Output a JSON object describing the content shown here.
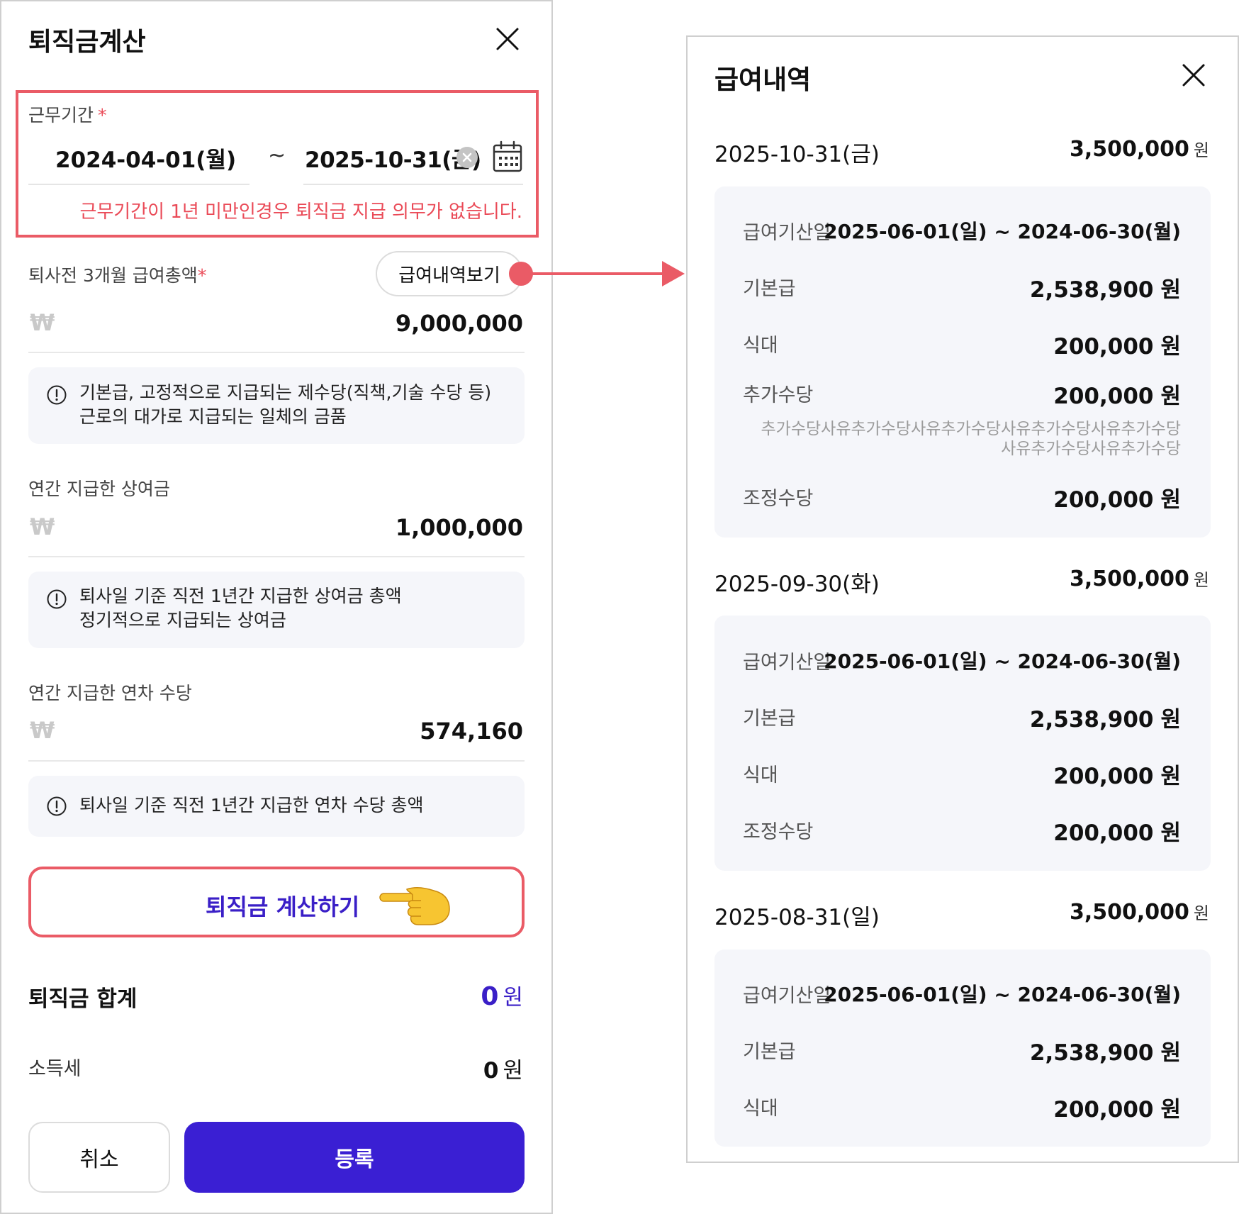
{
  "left_panel": {
    "title": "퇴직금계산",
    "period": {
      "label": "근무기간",
      "required_mark": "*",
      "start": "2024-04-01(월)",
      "separator": "~",
      "end": "2025-10-31(금)",
      "warning": "근무기간이 1년 미만인경우 퇴직금 지급 의무가 없습니다."
    },
    "salary3": {
      "label": "퇴사전 3개월 급여총액",
      "required_mark": "*",
      "history_button": "급여내역보기",
      "currency": "₩",
      "value": "9,000,000",
      "info_line1": "기본급, 고정적으로 지급되는 제수당(직책,기술 수당 등)",
      "info_line2": "근로의 대가로 지급되는 일체의 금품"
    },
    "bonus": {
      "label": "연간 지급한 상여금",
      "currency": "₩",
      "value": "1,000,000",
      "info_line1": "퇴사일 기준 직전 1년간 지급한 상여금 총액",
      "info_line2": "정기적으로 지급되는 상여금"
    },
    "leave": {
      "label": "연간 지급한 연차 수당",
      "currency": "₩",
      "value": "574,160",
      "info_line1": "퇴사일 기준 직전 1년간 지급한 연차 수당 총액"
    },
    "calc_button": "퇴직금 계산하기",
    "total": {
      "label": "퇴직금 합계",
      "value": "0",
      "unit": "원"
    },
    "tax": {
      "label": "소득세",
      "value": "0",
      "unit": "원"
    },
    "cancel_button": "취소",
    "submit_button": "등록"
  },
  "right_panel": {
    "title": "급여내역",
    "records": [
      {
        "date": "2025-10-31(금)",
        "total": "3,500,000",
        "total_unit": "원",
        "period_label": "급여기산일",
        "period": "2025-06-01(일) ~ 2024-06-30(월)",
        "items": [
          {
            "label": "기본급",
            "amount": "2,538,900",
            "unit": "원"
          },
          {
            "label": "식대",
            "amount": "200,000",
            "unit": "원"
          },
          {
            "label": "추가수당",
            "amount": "200,000",
            "unit": "원",
            "note": "추가수당사유추가수당사유추가수당사유추가수당사유추가수당사유추가수당사유추가수당"
          },
          {
            "label": "조정수당",
            "amount": "200,000",
            "unit": "원"
          }
        ]
      },
      {
        "date": "2025-09-30(화)",
        "total": "3,500,000",
        "total_unit": "원",
        "period_label": "급여기산일",
        "period": "2025-06-01(일) ~ 2024-06-30(월)",
        "items": [
          {
            "label": "기본급",
            "amount": "2,538,900",
            "unit": "원"
          },
          {
            "label": "식대",
            "amount": "200,000",
            "unit": "원"
          },
          {
            "label": "조정수당",
            "amount": "200,000",
            "unit": "원"
          }
        ]
      },
      {
        "date": "2025-08-31(일)",
        "total": "3,500,000",
        "total_unit": "원",
        "period_label": "급여기산일",
        "period": "2025-06-01(일) ~ 2024-06-30(월)",
        "items": [
          {
            "label": "기본급",
            "amount": "2,538,900",
            "unit": "원"
          },
          {
            "label": "식대",
            "amount": "200,000",
            "unit": "원"
          }
        ]
      }
    ]
  },
  "colors": {
    "accent": "#3a1fd3",
    "highlight": "#ea5b66",
    "warning_text": "#ea4a57",
    "info_bg": "#f5f6fa"
  },
  "icons": [
    "close-icon",
    "clear-icon",
    "calendar-icon",
    "info-icon",
    "pointing-hand-icon",
    "arrow-right-icon"
  ]
}
